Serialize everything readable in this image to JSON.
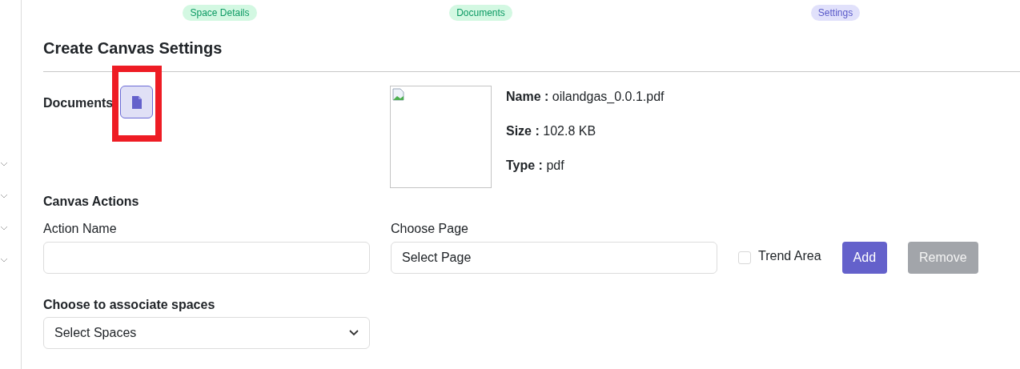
{
  "steps": [
    {
      "label": "Space Details",
      "selected": false
    },
    {
      "label": "Documents",
      "selected": false
    },
    {
      "label": "Settings",
      "selected": true
    }
  ],
  "title": "Create Canvas Settings",
  "documents": {
    "label": "Documents",
    "highlighted": true,
    "file": {
      "fields": [
        {
          "label": "Name :",
          "value": "oilandgas_0.0.1.pdf"
        },
        {
          "label": "Size :",
          "value": "102.8 KB"
        },
        {
          "label": "Type :",
          "value": "pdf"
        }
      ]
    }
  },
  "canvas_actions": {
    "heading": "Canvas Actions",
    "action_name": {
      "label": "Action Name"
    },
    "choose_page": {
      "label": "Choose Page",
      "value": "Select Page"
    },
    "trend_area": {
      "label": "Trend Area",
      "checked": false
    },
    "buttons": [
      {
        "label": "Add",
        "kind": "primary"
      },
      {
        "label": "Remove",
        "kind": "secondary"
      }
    ]
  },
  "associate": {
    "label": "Choose to associate spaces",
    "value": "Select Spaces"
  }
}
